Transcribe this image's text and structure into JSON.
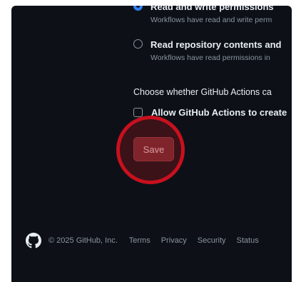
{
  "permissions": {
    "option_read_write": {
      "title": "Read and write permissions",
      "description": "Workflows have read and write perm",
      "checked": true
    },
    "option_read_only": {
      "title": "Read repository contents and",
      "description": "Workflows have read permissions in",
      "checked": false
    }
  },
  "pr_section": {
    "prompt": "Choose whether GitHub Actions ca",
    "checkbox_label": "Allow GitHub Actions to create",
    "checked": false
  },
  "actions": {
    "save_label": "Save"
  },
  "footer": {
    "logo_icon": "github-logo-icon",
    "copyright": "© 2025 GitHub, Inc.",
    "links": [
      "Terms",
      "Privacy",
      "Security",
      "Status"
    ]
  },
  "colors": {
    "background": "#0d1117",
    "accent": "#2f81f7",
    "danger_button": "#6b2a31",
    "highlight": "#c8101e"
  }
}
